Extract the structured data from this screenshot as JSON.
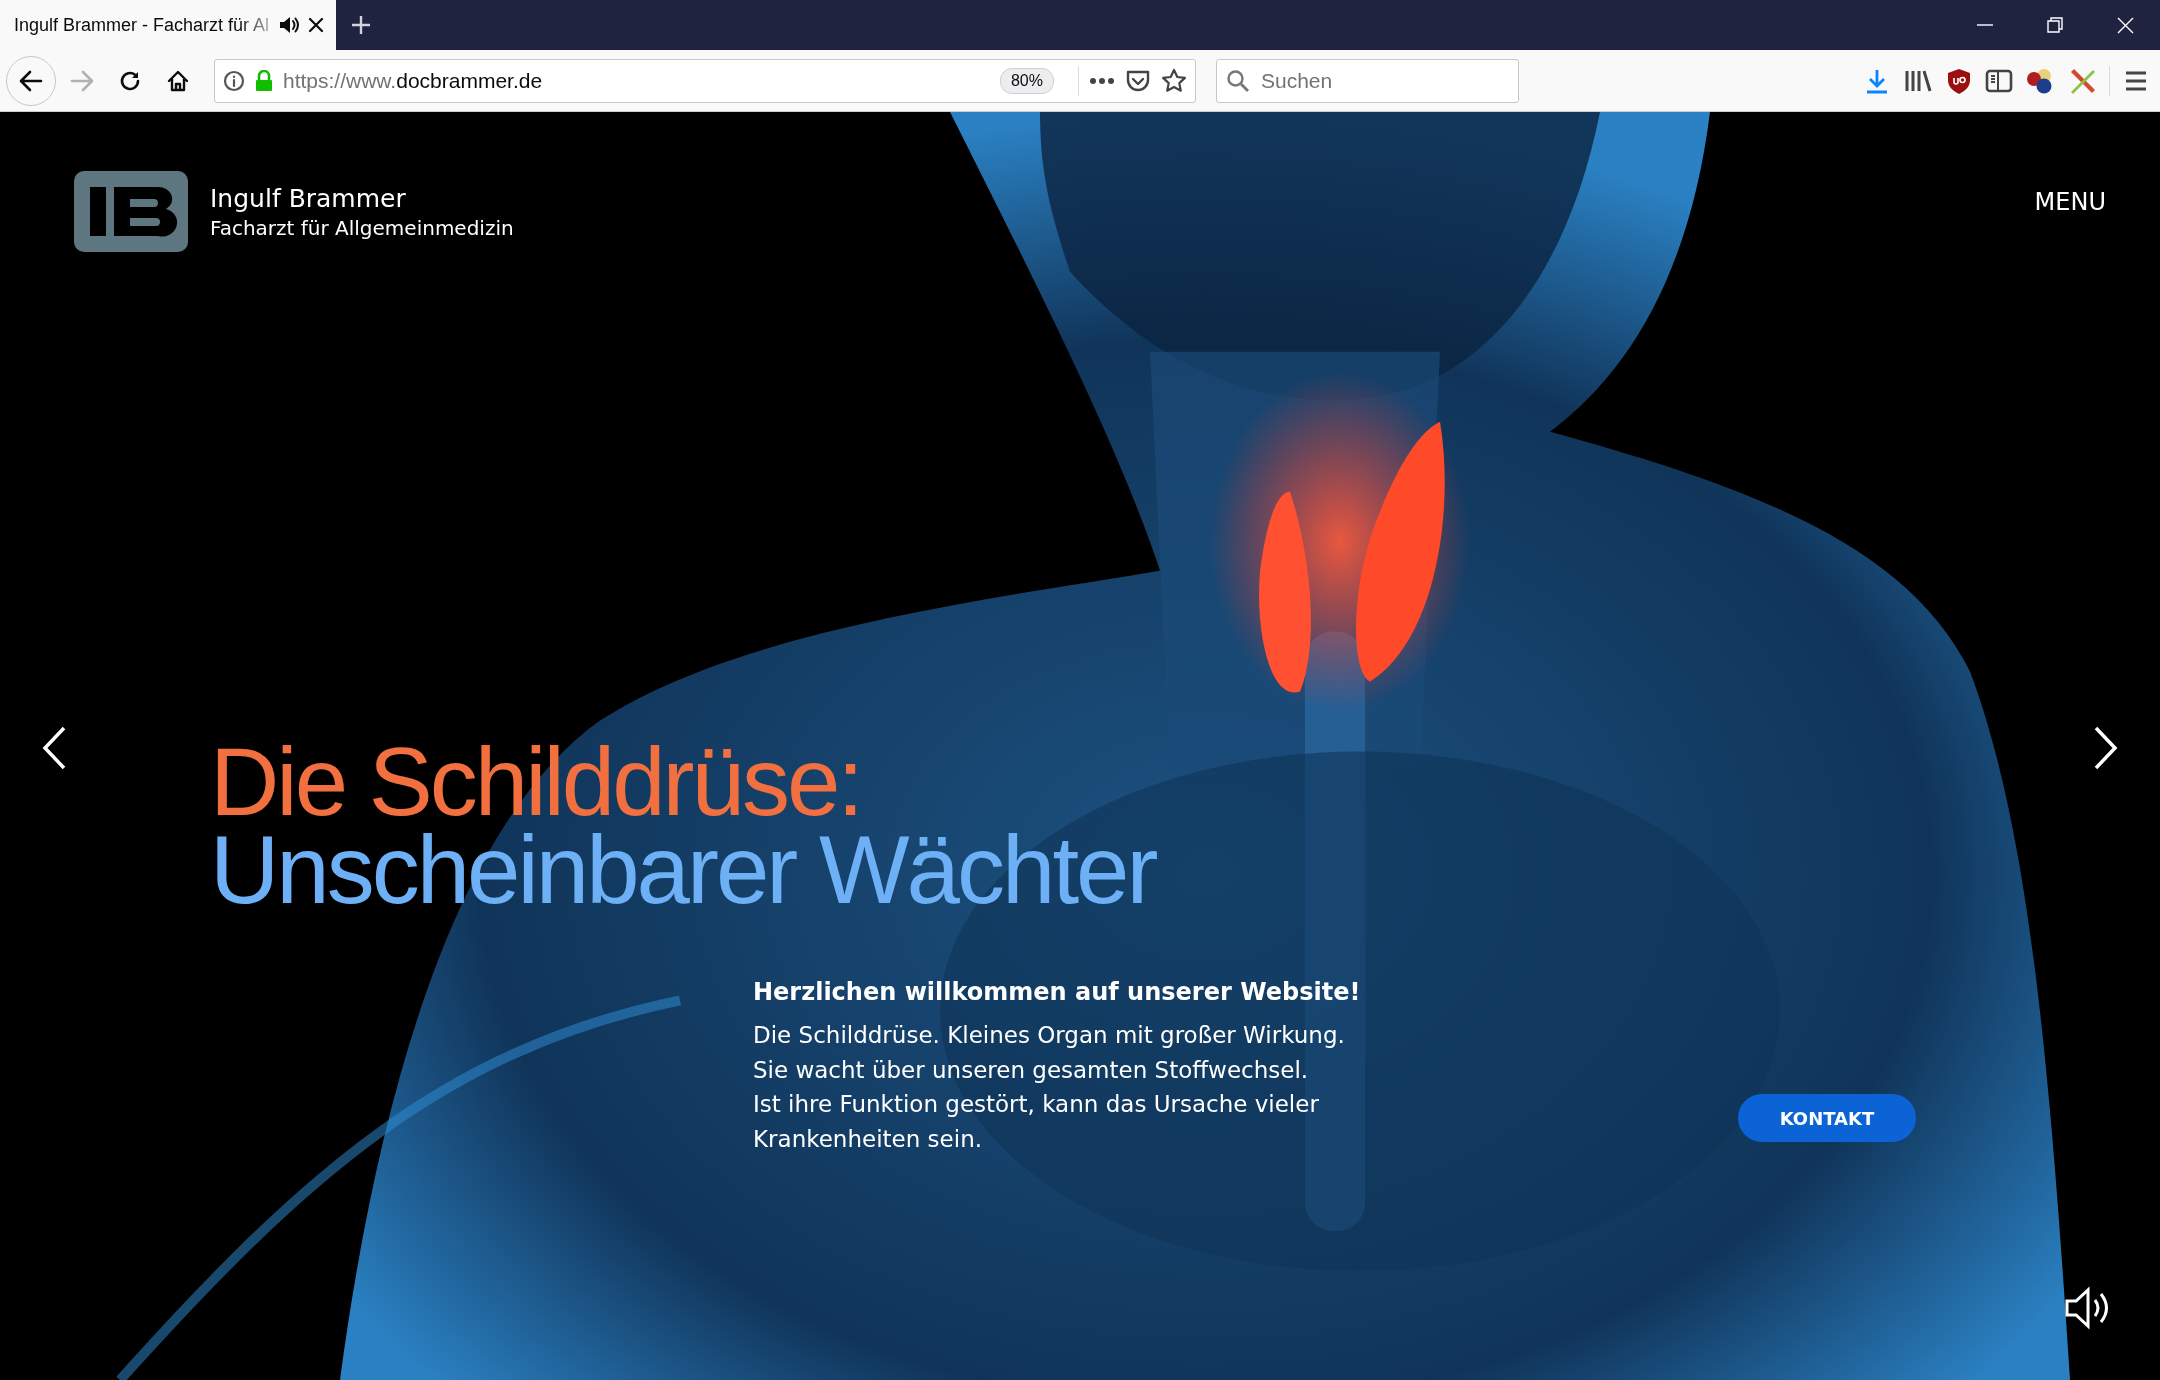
{
  "browser": {
    "tab": {
      "title": "Ingulf Brammer - Facharzt für Al",
      "selected": true
    },
    "address": {
      "scheme": "https://www.",
      "host": "docbrammer.de",
      "zoom": "80%"
    },
    "search": {
      "placeholder": "Suchen"
    },
    "back_enabled": true,
    "forward_enabled": false
  },
  "site": {
    "name": "Ingulf Brammer",
    "subtitle": "Facharzt für Allgemeinmedizin",
    "menu": "MENU"
  },
  "hero": {
    "headline": [
      "Die Schilddrüse:",
      "Unscheinbarer Wächter"
    ],
    "welcome_title": "Herzlichen willkommen auf unserer Website!",
    "welcome_lines": [
      "Die Schilddrüse. Kleines Organ mit großer Wirkung.",
      "Sie wacht über unseren gesamten Stoffwechsel.",
      "Ist ihre Funktion gestört, kann das Ursache vieler",
      "Krankenheiten sein."
    ],
    "button": "KONTAKT"
  }
}
